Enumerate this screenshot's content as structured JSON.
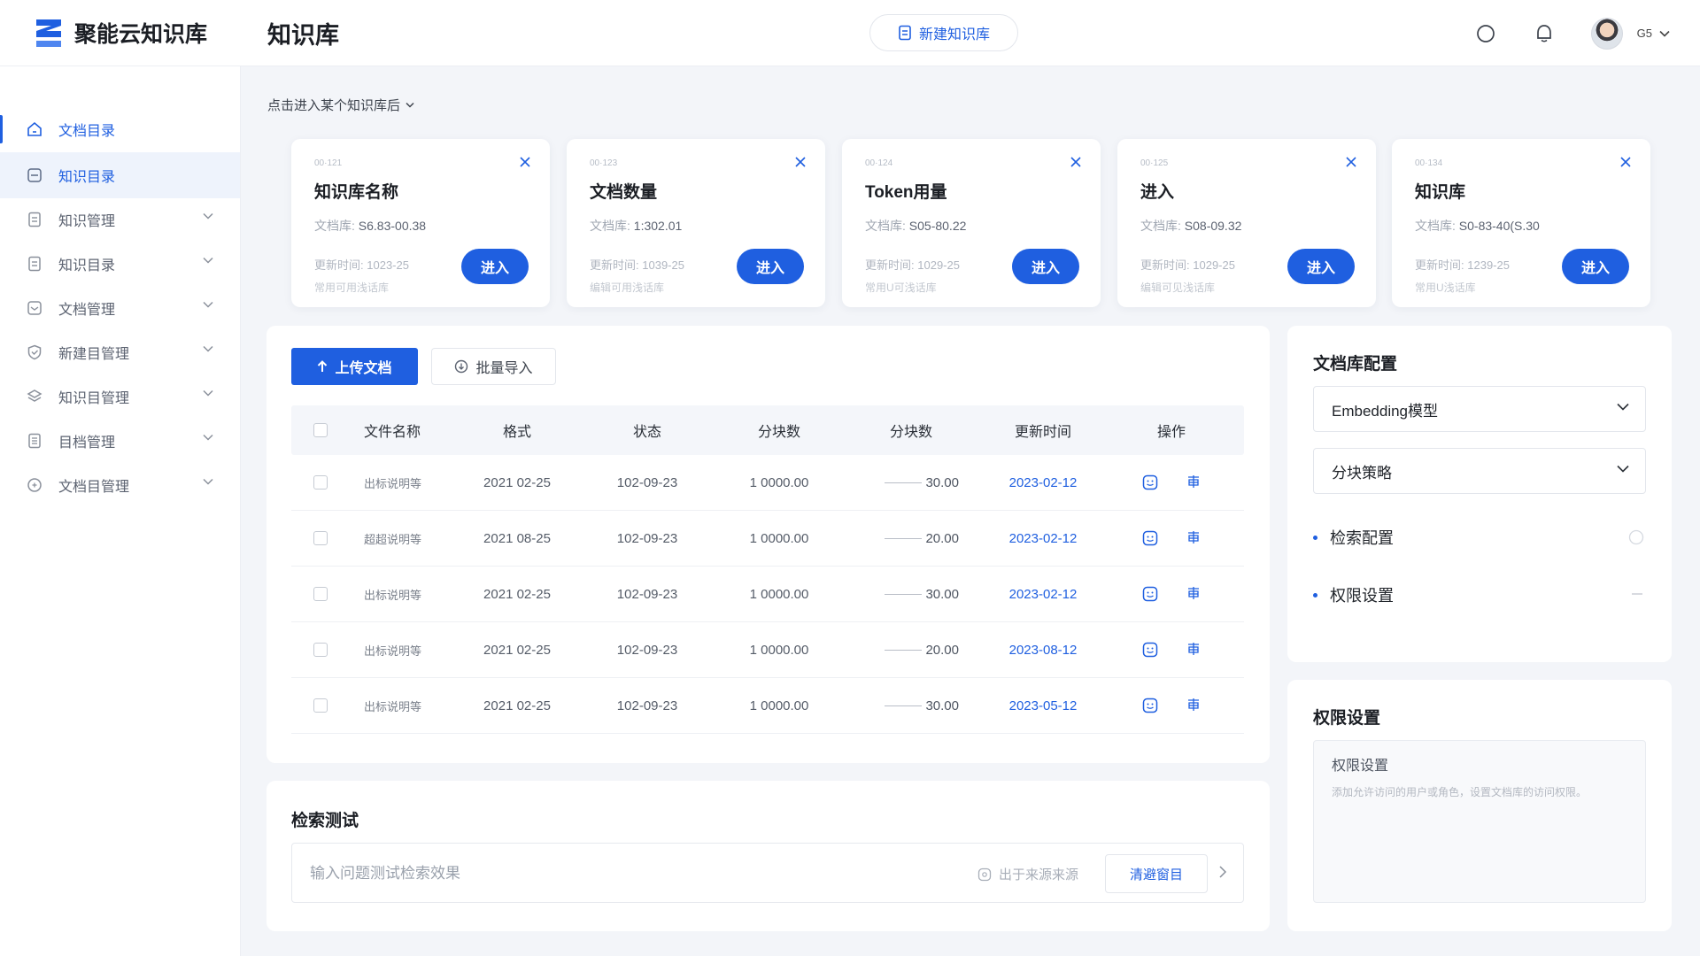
{
  "app": {
    "brand_name": "聚能云知识库",
    "page_title": "知识库",
    "new_kb_label": "新建知识库",
    "user_label": "G5"
  },
  "sidebar": {
    "items": [
      {
        "label": "文档目录",
        "icon": "home-icon",
        "state": "active"
      },
      {
        "label": "知识目录",
        "icon": "doc-icon",
        "state": "highlight"
      },
      {
        "label": "知识管理",
        "icon": "file-icon",
        "state": "collapsed"
      },
      {
        "label": "知识目录",
        "icon": "file-icon",
        "state": "collapsed"
      },
      {
        "label": "文档管理",
        "icon": "doc-icon",
        "state": "collapsed"
      },
      {
        "label": "新建目管理",
        "icon": "shield-icon",
        "state": "collapsed"
      },
      {
        "label": "知识目管理",
        "icon": "layers-icon",
        "state": "collapsed"
      },
      {
        "label": "目档管理",
        "icon": "list-icon",
        "state": "collapsed"
      },
      {
        "label": "文档目管理",
        "icon": "circle-icon",
        "state": "collapsed"
      }
    ]
  },
  "breadcrumb": {
    "label": "点击进入某个知识库后"
  },
  "kb_cards": [
    {
      "id": "00·121",
      "title": "知识库名称",
      "meta_label": "文档库:",
      "meta_value": "S6.83-00.38",
      "updated_label": "更新时间:",
      "updated_value": "1023-25",
      "desc": "常用可用浅话库",
      "enter_label": "进入"
    },
    {
      "id": "00·123",
      "title": "文档数量",
      "meta_label": "文档库:",
      "meta_value": "1:302.01",
      "updated_label": "更新时间:",
      "updated_value": "1039-25",
      "desc": "编辑可用浅话库",
      "enter_label": "进入"
    },
    {
      "id": "00·124",
      "title": "Token用量",
      "meta_label": "文档库:",
      "meta_value": "S05-80.22",
      "updated_label": "更新时间:",
      "updated_value": "1029-25",
      "desc": "常用U可浅话库",
      "enter_label": "进入"
    },
    {
      "id": "00·125",
      "title": "进入",
      "meta_label": "文档库:",
      "meta_value": "S08-09.32",
      "updated_label": "更新时间:",
      "updated_value": "1029-25",
      "desc": "编辑可见浅话库",
      "enter_label": "进入"
    },
    {
      "id": "00·134",
      "title": "知识库",
      "meta_label": "文档库:",
      "meta_value": "S0-83-40(S.30",
      "updated_label": "更新时间:",
      "updated_value": "1239-25",
      "desc": "常用U浅话库",
      "enter_label": "进入"
    }
  ],
  "doc_panel": {
    "upload_label": "上传文档",
    "import_label": "批量导入",
    "columns": [
      "文件名称",
      "格式",
      "状态",
      "分块数",
      "分块数",
      "更新时间",
      "操作"
    ],
    "rows": [
      {
        "name": "出标说明等",
        "format": "2021 02-25",
        "status": "102-09-23",
        "blocks": "1 0000.00",
        "blocks2": "30.00",
        "updated": "2023-02-12"
      },
      {
        "name": "超超说明等",
        "format": "2021 08-25",
        "status": "102-09-23",
        "blocks": "1 0000.00",
        "blocks2": "20.00",
        "updated": "2023-02-12"
      },
      {
        "name": "出标说明等",
        "format": "2021 02-25",
        "status": "102-09-23",
        "blocks": "1 0000.00",
        "blocks2": "30.00",
        "updated": "2023-02-12"
      },
      {
        "name": "出标说明等",
        "format": "2021 02-25",
        "status": "102-09-23",
        "blocks": "1 0000.00",
        "blocks2": "20.00",
        "updated": "2023-08-12"
      },
      {
        "name": "出标说明等",
        "format": "2021 02-25",
        "status": "102-09-23",
        "blocks": "1 0000.00",
        "blocks2": "30.00",
        "updated": "2023-05-12"
      }
    ]
  },
  "search_panel": {
    "title": "检索测试",
    "placeholder": "输入问题测试检索效果",
    "source_label": "出于来源来源",
    "clear_label": "清避窗目"
  },
  "config_panel": {
    "title": "文档库配置",
    "embedding_label": "Embedding模型",
    "chunk_label": "分块策略",
    "retrieval_label": "检索配置",
    "permission_label": "权限设置"
  },
  "perm_panel": {
    "title": "权限设置",
    "box_title": "权限设置",
    "box_desc": "添加允许访问的用户或角色，设置文档库的访问权限。"
  },
  "colors": {
    "accent": "#1f5fe0",
    "background": "#f3f5f9",
    "panel": "#ffffff"
  }
}
